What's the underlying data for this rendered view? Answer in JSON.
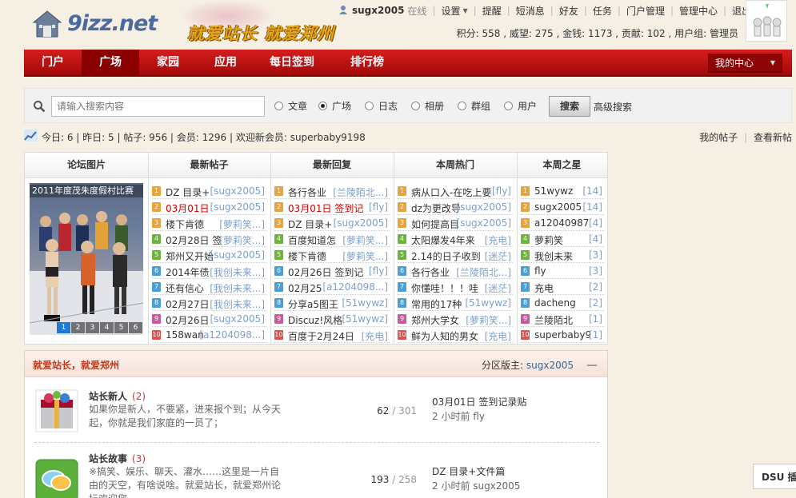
{
  "header": {
    "logo_text": "9izz.net",
    "slogan": "就爱站长 就爱郑州",
    "username": "sugx2005",
    "online": "在线",
    "links": [
      "设置",
      "提醒",
      "短消息",
      "好友",
      "任务",
      "门户管理",
      "管理中心",
      "退出"
    ],
    "stats": "积分: 558 , 威望: 275 , 金钱: 1173 , 贡献: 102 , 用户组: 管理员"
  },
  "nav": {
    "items": [
      "门户",
      "广场",
      "家园",
      "应用",
      "每日签到",
      "排行榜"
    ],
    "active": "广场",
    "my_center": "我的中心"
  },
  "search": {
    "placeholder": "请输入搜索内容",
    "options": [
      "文章",
      "广场",
      "日志",
      "相册",
      "群组",
      "用户"
    ],
    "selected": "广场",
    "button": "搜索",
    "advanced": "高级搜索"
  },
  "info": {
    "text": "今日: 6 | 昨日: 5 | 帖子: 956 | 会员: 1296 | 欢迎新会员: superbaby9198",
    "my_posts": "我的帖子",
    "view_new": "查看新帖"
  },
  "portal": {
    "headers": [
      "论坛图片",
      "最新帖子",
      "最新回复",
      "本周热门",
      "本周之星"
    ],
    "slide_caption": "2011年度茂朱度假村比赛",
    "slide_numbers": [
      "1",
      "2",
      "3",
      "4",
      "5",
      "6"
    ],
    "latest_posts": [
      {
        "title": "DZ 目录+",
        "author": "[sugx2005]",
        "hl": false
      },
      {
        "title": "03月01日",
        "author": "[sugx2005]",
        "hl": true
      },
      {
        "title": "楼下肯德",
        "author": "[萝莉笑...]",
        "hl": false
      },
      {
        "title": "02月28日 签",
        "author": "[萝莉笑...]",
        "hl": false
      },
      {
        "title": "郑州又开始",
        "author": "[sugx2005]",
        "hl": false
      },
      {
        "title": "2014年债",
        "author": "[我创未来...]",
        "hl": false
      },
      {
        "title": "还有信心",
        "author": "[我创未来...]",
        "hl": false
      },
      {
        "title": "02月27日",
        "author": "[我创未来...]",
        "hl": false
      },
      {
        "title": "02月26日",
        "author": "[sugx2005]",
        "hl": false
      },
      {
        "title": "158wan",
        "author": "[a1204098...]",
        "hl": false
      }
    ],
    "latest_replies": [
      {
        "title": "各行各业",
        "author": "[兰陵陌北...]",
        "hl": false
      },
      {
        "title": "03月01日 签到记",
        "author": "[fly]",
        "hl": true
      },
      {
        "title": "DZ 目录+",
        "author": "[sugx2005]",
        "hl": false
      },
      {
        "title": "百度知道怎",
        "author": "[萝莉笑...]",
        "hl": false
      },
      {
        "title": "楼下肯德",
        "author": "[萝莉笑...]",
        "hl": false
      },
      {
        "title": "02月26日 签到记",
        "author": "[fly]",
        "hl": false
      },
      {
        "title": "02月25",
        "author": "[a1204098...]",
        "hl": false
      },
      {
        "title": "分享a5图王",
        "author": "[51wywz]",
        "hl": false
      },
      {
        "title": "Discuz!风格",
        "author": "[51wywz]",
        "hl": false
      },
      {
        "title": "百度于2月24日",
        "author": "[充电]",
        "hl": false
      }
    ],
    "weekly_hot": [
      {
        "title": "病从口入-在吃上要",
        "author": "[fly]",
        "hl": false
      },
      {
        "title": "dz为更改导",
        "author": "[sugx2005]",
        "hl": false
      },
      {
        "title": "如何提高目",
        "author": "[sugx2005]",
        "hl": false
      },
      {
        "title": "太阳爆发4年来",
        "author": "[充电]",
        "hl": false
      },
      {
        "title": "2.14的日子收到",
        "author": "[迷茫]",
        "hl": false
      },
      {
        "title": "各行各业",
        "author": "[兰陵陌北...]",
        "hl": false
      },
      {
        "title": "你懂哇！！！哇",
        "author": "[迷茫]",
        "hl": false
      },
      {
        "title": "常用的17种",
        "author": "[51wywz]",
        "hl": false
      },
      {
        "title": "郑州大学女",
        "author": "[萝莉笑...]",
        "hl": false
      },
      {
        "title": "鲜为人知的男女",
        "author": "[充电]",
        "hl": false
      }
    ],
    "weekly_stars": [
      {
        "title": "51wywz",
        "author": "[14]",
        "hl": false
      },
      {
        "title": "sugx2005",
        "author": "[14]",
        "hl": false
      },
      {
        "title": "a12040987",
        "author": "[4]",
        "hl": false
      },
      {
        "title": "萝莉笑",
        "author": "[4]",
        "hl": false
      },
      {
        "title": "我创未来",
        "author": "[3]",
        "hl": false
      },
      {
        "title": "fly",
        "author": "[3]",
        "hl": false
      },
      {
        "title": "充电",
        "author": "[2]",
        "hl": false
      },
      {
        "title": "dacheng",
        "author": "[2]",
        "hl": false
      },
      {
        "title": "兰陵陌北",
        "author": "[1]",
        "hl": false
      },
      {
        "title": "superbaby9",
        "author": "[1]",
        "hl": false
      }
    ],
    "rank_colors": [
      "#e8a33c",
      "#e8a33c",
      "#e8a33c",
      "#6fb33f",
      "#6fb33f",
      "#4a9fd6",
      "#4a9fd6",
      "#4a9fd6",
      "#c95a9c",
      "#d9534f"
    ]
  },
  "forum": {
    "title": "就爱站长，就爱郑州",
    "moderator_label": "分区版主:",
    "moderator": "sugx2005",
    "boards": [
      {
        "name": "站长新人",
        "count": "(2)",
        "desc": "如果你是新人，不要紧，进来报个到；从今天起，你就是我们家庭的一员了；",
        "threads": "62",
        "posts": "/ 301",
        "last_title": "03月01日 签到记录贴",
        "last_time": "2 小时前",
        "last_user": "fly"
      },
      {
        "name": "站长故事",
        "count": "(3)",
        "desc": "※搞笑、娱乐、聊天、灌水……这里是一片自由的天空，有啥说啥。就爱站长，就爱郑州论坛欢迎您",
        "threads": "193",
        "posts": "/ 258",
        "last_title": "DZ 目录+文件篇",
        "last_time": "2 小时前",
        "last_user": "sugx2005"
      }
    ]
  },
  "side_widget": "DSU 插件"
}
